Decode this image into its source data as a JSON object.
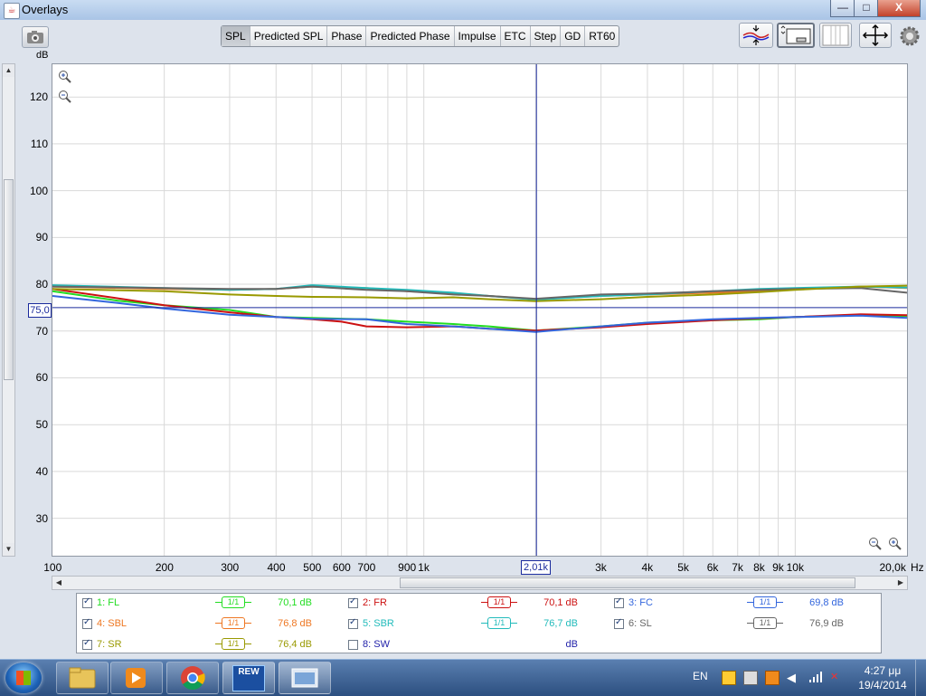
{
  "window": {
    "title": "Overlays",
    "controls": {
      "minimize": "—",
      "maximize": "□",
      "close": "X"
    }
  },
  "toolbar": {
    "tabs": [
      {
        "label": "SPL",
        "active": true
      },
      {
        "label": "Predicted SPL",
        "active": false
      },
      {
        "label": "Phase",
        "active": false
      },
      {
        "label": "Predicted Phase",
        "active": false
      },
      {
        "label": "Impulse",
        "active": false
      },
      {
        "label": "ETC",
        "active": false
      },
      {
        "label": "Step",
        "active": false
      },
      {
        "label": "GD",
        "active": false
      },
      {
        "label": "RT60",
        "active": false
      }
    ],
    "icons": [
      "camera-icon",
      "fit-curves-icon",
      "limits-icon",
      "split-view-icon",
      "pan-arrows-icon",
      "settings-gear-icon"
    ]
  },
  "chart_data": {
    "type": "line",
    "ylabel": "dB",
    "xlabel": "Hz",
    "x_scale": "log",
    "xlim": [
      100,
      20000
    ],
    "ylim": [
      22,
      127
    ],
    "grid": true,
    "y_ticks": [
      30,
      40,
      50,
      60,
      70,
      80,
      90,
      100,
      110,
      120
    ],
    "y_tick_labels": [
      "30",
      "40",
      "50",
      "60",
      "70",
      "80",
      "90",
      "100",
      "110",
      "120"
    ],
    "x_ticks": [
      100,
      200,
      300,
      400,
      500,
      600,
      700,
      900,
      1000,
      3000,
      4000,
      5000,
      6000,
      7000,
      8000,
      9000,
      10000,
      20000
    ],
    "x_tick_labels": [
      "100",
      "200",
      "300",
      "400",
      "500",
      "600",
      "700",
      "900",
      "1k",
      "3k",
      "4k",
      "5k",
      "6k",
      "7k",
      "8k",
      "9k",
      "10k",
      "20,0k"
    ],
    "cursor": {
      "y": 75.0,
      "y_label": "75,0",
      "x": 2010,
      "x_label": "2,01k"
    },
    "series": [
      {
        "name": "1: FL",
        "color": "#22dd22",
        "points": [
          [
            100,
            78.5
          ],
          [
            150,
            76.5
          ],
          [
            200,
            75.5
          ],
          [
            300,
            74.5
          ],
          [
            400,
            73
          ],
          [
            500,
            72.8
          ],
          [
            700,
            72.5
          ],
          [
            900,
            72
          ],
          [
            1200,
            71.5
          ],
          [
            1500,
            71
          ],
          [
            2000,
            70.1
          ],
          [
            3000,
            71
          ],
          [
            4000,
            71.8
          ],
          [
            6000,
            72.3
          ],
          [
            8000,
            72.5
          ],
          [
            10000,
            73
          ],
          [
            15000,
            73.4
          ],
          [
            20000,
            73.2
          ]
        ]
      },
      {
        "name": "2: FR",
        "color": "#cc1111",
        "points": [
          [
            100,
            79
          ],
          [
            150,
            77
          ],
          [
            200,
            75.5
          ],
          [
            300,
            74
          ],
          [
            400,
            73
          ],
          [
            500,
            72.5
          ],
          [
            600,
            72
          ],
          [
            700,
            71
          ],
          [
            900,
            70.8
          ],
          [
            1200,
            71
          ],
          [
            1500,
            70.5
          ],
          [
            2000,
            70.1
          ],
          [
            3000,
            70.8
          ],
          [
            4000,
            71.5
          ],
          [
            6000,
            72.3
          ],
          [
            8000,
            72.7
          ],
          [
            10000,
            73
          ],
          [
            15000,
            73.6
          ],
          [
            20000,
            73.4
          ]
        ]
      },
      {
        "name": "3: FC",
        "color": "#3366dd",
        "points": [
          [
            100,
            77.5
          ],
          [
            150,
            76
          ],
          [
            200,
            74.8
          ],
          [
            300,
            73.5
          ],
          [
            400,
            73
          ],
          [
            500,
            72.6
          ],
          [
            700,
            72.5
          ],
          [
            900,
            71.5
          ],
          [
            1200,
            71
          ],
          [
            1500,
            70.5
          ],
          [
            2000,
            69.8
          ],
          [
            3000,
            71
          ],
          [
            4000,
            71.8
          ],
          [
            6000,
            72.5
          ],
          [
            8000,
            72.8
          ],
          [
            10000,
            73
          ],
          [
            15000,
            73.3
          ],
          [
            20000,
            72.8
          ]
        ]
      },
      {
        "name": "4: SBL",
        "color": "#ee7722",
        "points": [
          [
            100,
            79.5
          ],
          [
            200,
            79
          ],
          [
            300,
            78.8
          ],
          [
            400,
            79
          ],
          [
            500,
            79.5
          ],
          [
            700,
            79.2
          ],
          [
            900,
            78.5
          ],
          [
            1200,
            78
          ],
          [
            1500,
            77.5
          ],
          [
            2000,
            76.8
          ],
          [
            3000,
            77.5
          ],
          [
            4000,
            77.8
          ],
          [
            6000,
            78.2
          ],
          [
            8000,
            78.5
          ],
          [
            10000,
            79
          ],
          [
            15000,
            79.5
          ],
          [
            20000,
            79.2
          ]
        ]
      },
      {
        "name": "5: SBR",
        "color": "#22bbbb",
        "points": [
          [
            100,
            79.8
          ],
          [
            200,
            79.2
          ],
          [
            300,
            78.8
          ],
          [
            400,
            79
          ],
          [
            500,
            79.8
          ],
          [
            700,
            79.2
          ],
          [
            900,
            78.8
          ],
          [
            1200,
            78.2
          ],
          [
            1500,
            77.5
          ],
          [
            2000,
            76.7
          ],
          [
            3000,
            77.5
          ],
          [
            4000,
            77.8
          ],
          [
            6000,
            78.5
          ],
          [
            8000,
            79
          ],
          [
            10000,
            79.2
          ],
          [
            15000,
            79.5
          ],
          [
            20000,
            79.3
          ]
        ]
      },
      {
        "name": "6: SL",
        "color": "#666666",
        "points": [
          [
            100,
            79.5
          ],
          [
            200,
            79.2
          ],
          [
            300,
            79
          ],
          [
            400,
            79
          ],
          [
            500,
            79.5
          ],
          [
            700,
            78.8
          ],
          [
            900,
            78.5
          ],
          [
            1200,
            77.8
          ],
          [
            1500,
            77.5
          ],
          [
            2000,
            76.9
          ],
          [
            3000,
            77.8
          ],
          [
            4000,
            78
          ],
          [
            6000,
            78.5
          ],
          [
            8000,
            78.8
          ],
          [
            10000,
            79
          ],
          [
            15000,
            79.2
          ],
          [
            20000,
            78.2
          ]
        ]
      },
      {
        "name": "7: SR",
        "color": "#999900",
        "points": [
          [
            100,
            79
          ],
          [
            200,
            78.5
          ],
          [
            300,
            77.8
          ],
          [
            400,
            77.5
          ],
          [
            500,
            77.3
          ],
          [
            700,
            77.2
          ],
          [
            900,
            77
          ],
          [
            1200,
            77.2
          ],
          [
            1500,
            76.8
          ],
          [
            2000,
            76.4
          ],
          [
            3000,
            76.8
          ],
          [
            4000,
            77.3
          ],
          [
            6000,
            77.8
          ],
          [
            8000,
            78.3
          ],
          [
            10000,
            78.8
          ],
          [
            15000,
            79.5
          ],
          [
            20000,
            79.7
          ]
        ]
      },
      {
        "name": "8: SW",
        "color": "#2222aa",
        "points": []
      }
    ]
  },
  "legend": [
    {
      "name": "1: FL",
      "checked": true,
      "smoothing": "1/1",
      "value": "70,1 dB",
      "color": "#22dd22"
    },
    {
      "name": "2: FR",
      "checked": true,
      "smoothing": "1/1",
      "value": "70,1 dB",
      "color": "#cc1111"
    },
    {
      "name": "3: FC",
      "checked": true,
      "smoothing": "1/1",
      "value": "69,8 dB",
      "color": "#3366dd"
    },
    {
      "name": "4: SBL",
      "checked": true,
      "smoothing": "1/1",
      "value": "76,8 dB",
      "color": "#ee7722"
    },
    {
      "name": "5: SBR",
      "checked": true,
      "smoothing": "1/1",
      "value": "76,7 dB",
      "color": "#22bbbb"
    },
    {
      "name": "6: SL",
      "checked": true,
      "smoothing": "1/1",
      "value": "76,9 dB",
      "color": "#666666"
    },
    {
      "name": "7: SR",
      "checked": true,
      "smoothing": "1/1",
      "value": "76,4 dB",
      "color": "#999900"
    },
    {
      "name": "8: SW",
      "checked": false,
      "smoothing": "",
      "value": "dB",
      "color": "#2222aa"
    }
  ],
  "taskbar": {
    "apps": [
      "explorer-icon",
      "media-player-icon",
      "chrome-icon",
      "rew-icon",
      "overlay-window-icon"
    ],
    "rew_label": "REW",
    "language": "EN",
    "time": "4:27 μμ",
    "date": "19/4/2014"
  }
}
